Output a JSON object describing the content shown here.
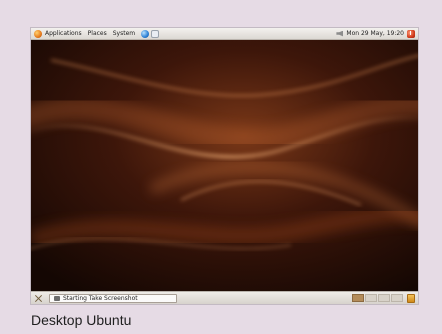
{
  "top_panel": {
    "menus": [
      "Applications",
      "Places",
      "System"
    ],
    "clock": "Mon 29 May, 19:20"
  },
  "bottom_panel": {
    "task": "Starting Take Screenshot",
    "workspaces": 4,
    "active_workspace": 1
  },
  "caption": "Desktop Ubuntu",
  "colors": {
    "wallpaper_dark": "#1e0c06",
    "wallpaper_light": "#c9733a",
    "page_bg": "#e6dbe5"
  },
  "icons": {
    "menu": "ubuntu-foot-icon",
    "browser": "globe-icon",
    "help": "help-icon",
    "volume": "speaker-icon",
    "logout": "logout-icon",
    "show_desktop": "show-desktop-icon",
    "trash": "trash-icon"
  }
}
